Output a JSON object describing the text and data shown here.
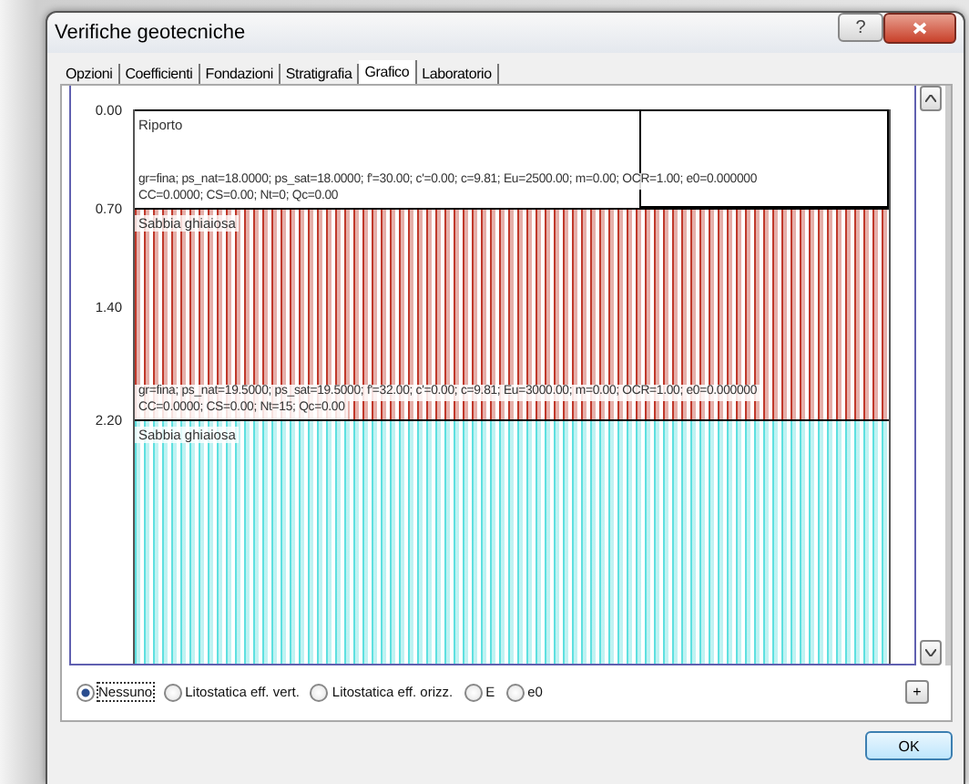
{
  "window": {
    "title": "Verifiche geotecniche",
    "help_button": "?"
  },
  "tabs": [
    {
      "label": "Opzioni",
      "selected": false
    },
    {
      "label": "Coefficienti",
      "selected": false
    },
    {
      "label": "Fondazioni",
      "selected": false
    },
    {
      "label": "Stratigrafia",
      "selected": false
    },
    {
      "label": "Grafico",
      "selected": true
    },
    {
      "label": "Laboratorio",
      "selected": false
    }
  ],
  "depth_ticks": [
    "0.00",
    "0.70",
    "1.40",
    "2.20"
  ],
  "layers": [
    {
      "kind": "plain",
      "name": "Riporto",
      "params": [
        "gr=fina; ps_nat=18.0000; ps_sat=18.0000; f'=30.00; c'=0.00; c=9.81; Eu=2500.00; m=0.00; OCR=1.00; e0=0.000000",
        "CC=0.0000; CS=0.00; Nt=0; Qc=0.00"
      ]
    },
    {
      "kind": "striped",
      "color": "#c0392b",
      "name": "Sabbia ghiaiosa",
      "params": [
        "gr=fina; ps_nat=19.5000; ps_sat=19.5000; f'=32.00; c'=0.00; c=9.81; Eu=3000.00; m=0.00; OCR=1.00; e0=0.000000",
        "CC=0.0000; CS=0.00; Nt=15; Qc=0.00"
      ]
    },
    {
      "kind": "striped",
      "color": "#5ee0e0",
      "name": "Sabbia ghiaiosa"
    }
  ],
  "diagram_options": [
    {
      "label": "Nessuno",
      "selected": true
    },
    {
      "label": "Litostatica eff. vert.",
      "selected": false
    },
    {
      "label": "Litostatica eff. orizz.",
      "selected": false
    },
    {
      "label": "E",
      "selected": false
    },
    {
      "label": "e0",
      "selected": false
    }
  ],
  "expand_button": "+",
  "ok_button": "OK"
}
